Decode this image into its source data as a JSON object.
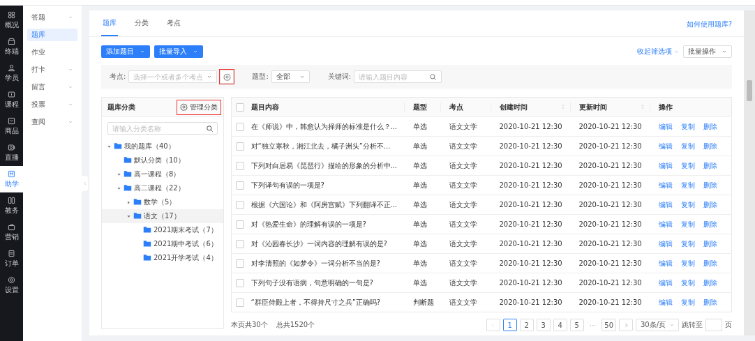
{
  "nav": [
    {
      "label": "概况",
      "selected": false
    },
    {
      "label": "终端",
      "selected": false
    },
    {
      "label": "学员",
      "selected": false
    },
    {
      "label": "课程",
      "selected": false
    },
    {
      "label": "商品",
      "selected": false
    },
    {
      "label": "直播",
      "selected": false
    },
    {
      "label": "助学",
      "selected": true
    },
    {
      "label": "教务",
      "selected": false
    },
    {
      "label": "营销",
      "selected": false
    },
    {
      "label": "订单",
      "selected": false
    },
    {
      "label": "设置",
      "selected": false
    }
  ],
  "subnav": [
    {
      "label": "答题",
      "expandable": true,
      "selected": false
    },
    {
      "label": "题库",
      "expandable": false,
      "selected": true
    },
    {
      "label": "作业",
      "expandable": false,
      "selected": false
    },
    {
      "label": "打卡",
      "expandable": true,
      "selected": false
    },
    {
      "label": "留言",
      "expandable": true,
      "selected": false
    },
    {
      "label": "投票",
      "expandable": true,
      "selected": false
    },
    {
      "label": "查阅",
      "expandable": true,
      "selected": false
    }
  ],
  "tabs": [
    {
      "label": "题库",
      "selected": true
    },
    {
      "label": "分类",
      "selected": false
    },
    {
      "label": "考点",
      "selected": false
    }
  ],
  "help_link": "如何使用题库?",
  "actions": [
    {
      "label": "添加题目"
    },
    {
      "label": "批量导入"
    }
  ],
  "collapse_filters": "收起筛选项",
  "batch_select": "批量操作",
  "filters": {
    "point_label": "考点:",
    "point_placeholder": "选择一个或者多个考点",
    "point_gear_highlighted": true,
    "type_label": "题型:",
    "type_value": "全部",
    "keyword_label": "关键词:",
    "keyword_placeholder": "请输入题目内容"
  },
  "category_panel": {
    "title": "题库分类",
    "manage": "管理分类",
    "manage_highlighted": true,
    "search_placeholder": "请输入分类名称",
    "tree": [
      {
        "label": "我的题库（40）",
        "expanded": true,
        "selected": false,
        "children": [
          {
            "label": "默认分类（10）",
            "selected": false
          },
          {
            "label": "高一课程（8）",
            "expanded": true,
            "selected": false
          },
          {
            "label": "高二课程（22）",
            "expanded": true,
            "selected": false,
            "children": [
              {
                "label": "数学（5）",
                "expanded": false,
                "selected": false
              },
              {
                "label": "语文（17）",
                "expanded": true,
                "selected": true,
                "children": [
                  {
                    "label": "2021期末考试（7）",
                    "selected": false
                  },
                  {
                    "label": "2021期中考试（6）",
                    "selected": false
                  },
                  {
                    "label": "2021开学考试（4）",
                    "selected": false
                  }
                ]
              }
            ]
          }
        ]
      }
    ]
  },
  "table": {
    "header_checked": false,
    "columns": [
      {
        "label": "题目内容",
        "sortable": false
      },
      {
        "label": "题型",
        "sortable": false
      },
      {
        "label": "考点",
        "sortable": false
      },
      {
        "label": "创建时间",
        "sortable": true
      },
      {
        "label": "更新时间",
        "sortable": true
      },
      {
        "label": "操作",
        "sortable": false
      }
    ],
    "rows": [
      {
        "checked": false,
        "content": "在《师说》中，韩愈认为择师的标准是什么？...",
        "type": "单选",
        "point": "语文文学",
        "created": "2020-10-21 12:30",
        "updated": "2020-10-21 12:30",
        "ops": [
          "编辑",
          "复制",
          "删除"
        ]
      },
      {
        "checked": false,
        "content": "对“独立寒秋，湘江北去，橘子洲头”分析不...",
        "type": "单选",
        "point": "语文文学",
        "created": "2020-10-21 12:30",
        "updated": "2020-10-21 12:30",
        "ops": [
          "编辑",
          "复制",
          "删除"
        ]
      },
      {
        "checked": false,
        "content": "下列对白居易《琵琶行》描绘的形象的分析中...",
        "type": "单选",
        "point": "语文文学",
        "created": "2020-10-21 12:30",
        "updated": "2020-10-21 12:30",
        "ops": [
          "编辑",
          "复制",
          "删除"
        ]
      },
      {
        "checked": false,
        "content": "下列译句有误的一项是?",
        "type": "单选",
        "point": "语文文学",
        "created": "2020-10-21 12:30",
        "updated": "2020-10-21 12:30",
        "ops": [
          "编辑",
          "复制",
          "删除"
        ]
      },
      {
        "checked": false,
        "content": "根据《六国论》和《阿房宫赋》下列翻译不正...",
        "type": "单选",
        "point": "语文文学",
        "created": "2020-10-21 12:30",
        "updated": "2020-10-21 12:30",
        "ops": [
          "编辑",
          "复制",
          "删除"
        ]
      },
      {
        "checked": false,
        "content": "对《热爱生命》的理解有误的一项是?",
        "type": "单选",
        "point": "语文文学",
        "created": "2020-10-21 12:30",
        "updated": "2020-10-21 12:30",
        "ops": [
          "编辑",
          "复制",
          "删除"
        ]
      },
      {
        "checked": false,
        "content": "对《沁园春长沙》一词内容的理解有误的是?",
        "type": "单选",
        "point": "语文文学",
        "created": "2020-10-21 12:30",
        "updated": "2020-10-21 12:30",
        "ops": [
          "编辑",
          "复制",
          "删除"
        ]
      },
      {
        "checked": false,
        "content": "对李清照的《如梦令》一词分析不当的是?",
        "type": "单选",
        "point": "语文文学",
        "created": "2020-10-21 12:30",
        "updated": "2020-10-21 12:30",
        "ops": [
          "编辑",
          "复制",
          "删除"
        ]
      },
      {
        "checked": false,
        "content": "下列句子没有语病，句意明确的一句是?",
        "type": "单选",
        "point": "语文文学",
        "created": "2020-10-21 12:30",
        "updated": "2020-10-21 12:30",
        "ops": [
          "编辑",
          "复制",
          "删除"
        ]
      },
      {
        "checked": false,
        "content": "“群臣侍殿上者，不得持尺寸之兵”正确吗?",
        "type": "判断题",
        "point": "语文文学",
        "created": "2020-10-21 12:30",
        "updated": "2020-10-21 12:30",
        "ops": [
          "编辑",
          "复制",
          "删除"
        ]
      }
    ]
  },
  "footer": {
    "page_count": "本页共30个",
    "total": "总共1520个"
  },
  "pagination": {
    "prev_disabled": true,
    "next_disabled": false,
    "pages": [
      {
        "label": "1",
        "kind": "page",
        "selected": true
      },
      {
        "label": "2",
        "kind": "page",
        "selected": false
      },
      {
        "label": "3",
        "kind": "page",
        "selected": false
      },
      {
        "label": "4",
        "kind": "page",
        "selected": false
      },
      {
        "label": "5",
        "kind": "page",
        "selected": false
      },
      {
        "label": "···",
        "kind": "ellipsis"
      },
      {
        "label": "50",
        "kind": "page",
        "selected": false
      }
    ],
    "page_size": "30条/页",
    "jump_label": "跳转至",
    "jump_suffix": "页"
  }
}
